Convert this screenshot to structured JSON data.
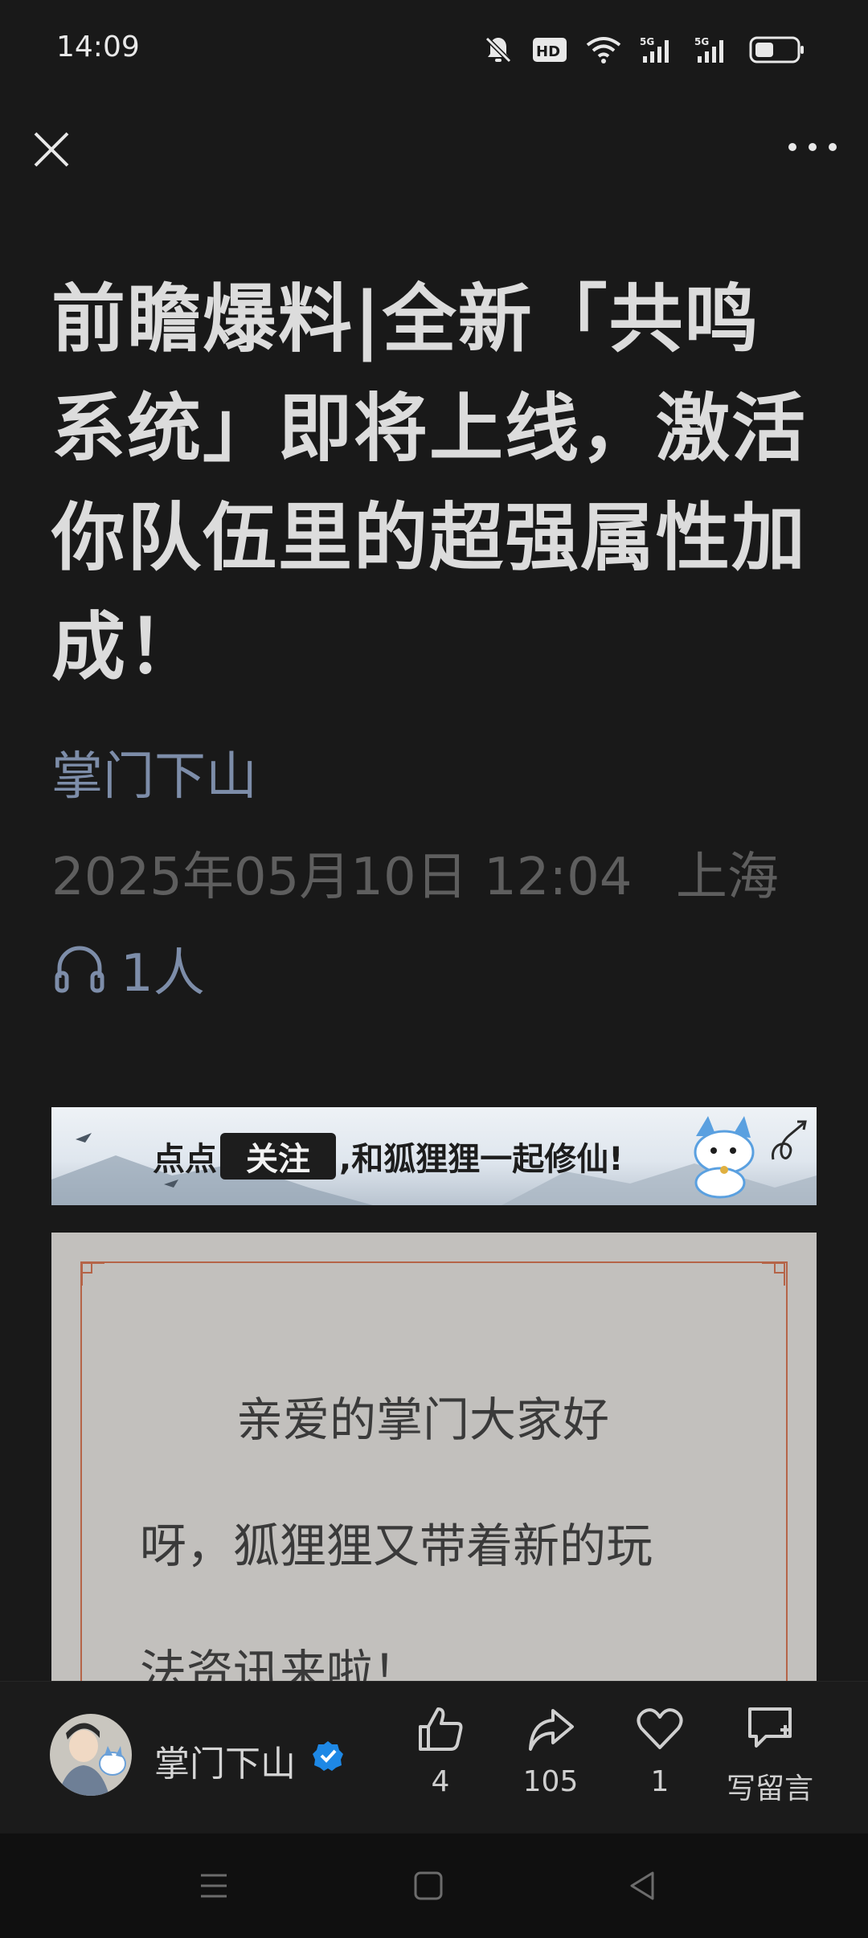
{
  "status_bar": {
    "time": "14:09"
  },
  "article": {
    "title": "前瞻爆料|全新「共鸣系统」即将上线，激活你队伍里的超强属性加成！",
    "author": "掌门下山",
    "date_time": "2025年05月10日 12:04",
    "location": "上海",
    "listeners": "1人"
  },
  "banner": {
    "prefix": "点点",
    "follow": "关注",
    "suffix": ",和狐狸狸一起修仙!"
  },
  "content_card": {
    "line1": "亲爱的掌门大家好",
    "line2": "呀，狐狸狸又带着新的玩",
    "line3": "法资讯来啦！"
  },
  "bottom_bar": {
    "author": "掌门下山",
    "like_count": "4",
    "share_count": "105",
    "favorite_count": "1",
    "comment_label": "写留言"
  },
  "colors": {
    "background": "#191919",
    "author_link": "#7d8da9",
    "card_bg": "#c2c0bd",
    "verified": "#1e88e5"
  }
}
